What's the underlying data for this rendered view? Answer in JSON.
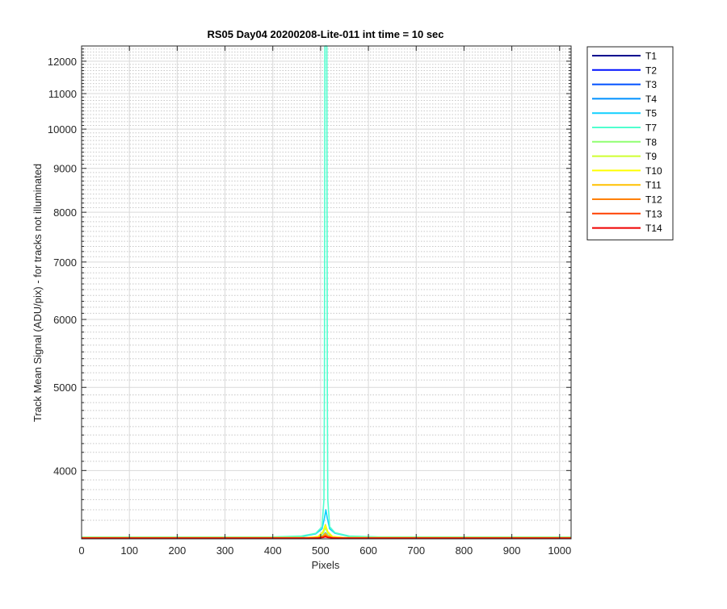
{
  "chart_data": {
    "type": "line",
    "title": "RS05 Day04 20200208-Lite-011 int time = 10 sec",
    "xlabel": "Pixels",
    "ylabel": "Track Mean Signal (ADU/pix) - for tracks not illuminated",
    "xlim": [
      0,
      1024
    ],
    "ylim": [
      3330,
      12500
    ],
    "yscale": "log",
    "grid": true,
    "legend_position": "outside-top-right",
    "x_ticks": [
      0,
      100,
      200,
      300,
      400,
      500,
      600,
      700,
      800,
      900,
      1000
    ],
    "x_tick_labels": [
      "0",
      "100",
      "200",
      "300",
      "400",
      "500",
      "600",
      "700",
      "800",
      "900",
      "1000"
    ],
    "y_ticks": [
      4000,
      5000,
      6000,
      7000,
      8000,
      9000,
      10000,
      11000,
      12000
    ],
    "y_tick_labels": [
      "4000",
      "5000",
      "6000",
      "7000",
      "8000",
      "9000",
      "10000",
      "11000",
      "12000"
    ],
    "y_minor_ticks": [
      3500,
      3600,
      3700,
      3800,
      3900,
      4100,
      4200,
      4300,
      4400,
      4500,
      4600,
      4700,
      4800,
      4900,
      5100,
      5200,
      5300,
      5400,
      5500,
      5600,
      5700,
      5800,
      5900,
      6100,
      6200,
      6300,
      6400,
      6500,
      6600,
      6700,
      6800,
      6900,
      7100,
      7200,
      7300,
      7400,
      7500,
      7600,
      7700,
      7800,
      7900,
      8100,
      8200,
      8300,
      8400,
      8500,
      8600,
      8700,
      8800,
      8900,
      9100,
      9200,
      9300,
      9400,
      9500,
      9600,
      9700,
      9800,
      9900,
      10100,
      10200,
      10300,
      10400,
      10500,
      10600,
      10700,
      10800,
      10900,
      11100,
      11200,
      11300,
      11400,
      11500,
      11600,
      11700,
      11800,
      11900,
      12100,
      12200,
      12300,
      12400
    ],
    "series": [
      {
        "name": "T1",
        "color": "#00008f",
        "x": [
          0,
          480,
          495,
          505,
          510,
          515,
          525,
          540,
          1024
        ],
        "y": [
          3340,
          3340,
          3342,
          3350,
          3365,
          3350,
          3342,
          3340,
          3340
        ]
      },
      {
        "name": "T2",
        "color": "#0010ff",
        "x": [
          0,
          480,
          495,
          505,
          510,
          515,
          525,
          540,
          1024
        ],
        "y": [
          3340,
          3340,
          3343,
          3355,
          3375,
          3355,
          3343,
          3340,
          3340
        ]
      },
      {
        "name": "T3",
        "color": "#0050ff",
        "x": [
          0,
          480,
          495,
          505,
          510,
          515,
          525,
          540,
          1024
        ],
        "y": [
          3340,
          3340,
          3343,
          3356,
          3378,
          3356,
          3343,
          3340,
          3340
        ]
      },
      {
        "name": "T4",
        "color": "#0090ff",
        "x": [
          0,
          480,
          495,
          505,
          510,
          515,
          525,
          540,
          1024
        ],
        "y": [
          3341,
          3341,
          3345,
          3360,
          3385,
          3360,
          3345,
          3341,
          3341
        ]
      },
      {
        "name": "T5",
        "color": "#10d0ff",
        "x": [
          0,
          400,
          460,
          490,
          503,
          508,
          511,
          514,
          519,
          530,
          560,
          620,
          1024
        ],
        "y": [
          3345,
          3345,
          3350,
          3375,
          3420,
          3520,
          3600,
          3520,
          3420,
          3380,
          3352,
          3346,
          3345
        ]
      },
      {
        "name": "T7",
        "color": "#50ffcf",
        "x": [
          0,
          400,
          460,
          490,
          503,
          507,
          508,
          509,
          510,
          511,
          512,
          513,
          514,
          515,
          519,
          530,
          560,
          620,
          1024
        ],
        "y": [
          3345,
          3347,
          3355,
          3380,
          3440,
          3700,
          5000,
          12500,
          12500,
          12500,
          12500,
          12500,
          5000,
          3700,
          3440,
          3385,
          3355,
          3347,
          3345
        ]
      },
      {
        "name": "T8",
        "color": "#8fff70",
        "x": [
          0,
          470,
          495,
          505,
          510,
          515,
          525,
          550,
          1024
        ],
        "y": [
          3341,
          3341,
          3348,
          3380,
          3430,
          3380,
          3348,
          3341,
          3341
        ]
      },
      {
        "name": "T9",
        "color": "#cfff30",
        "x": [
          0,
          470,
          495,
          505,
          510,
          515,
          525,
          550,
          1024
        ],
        "y": [
          3341,
          3341,
          3350,
          3395,
          3460,
          3395,
          3350,
          3341,
          3341
        ]
      },
      {
        "name": "T10",
        "color": "#ffff00",
        "x": [
          0,
          470,
          495,
          505,
          510,
          515,
          525,
          550,
          1024
        ],
        "y": [
          3340,
          3340,
          3349,
          3390,
          3450,
          3390,
          3349,
          3340,
          3340
        ]
      },
      {
        "name": "T11",
        "color": "#ffc000",
        "x": [
          0,
          480,
          495,
          505,
          510,
          515,
          525,
          540,
          1024
        ],
        "y": [
          3339,
          3339,
          3343,
          3358,
          3380,
          3358,
          3343,
          3339,
          3339
        ]
      },
      {
        "name": "T12",
        "color": "#ff8000",
        "x": [
          0,
          480,
          495,
          505,
          510,
          515,
          525,
          540,
          1024
        ],
        "y": [
          3338,
          3338,
          3341,
          3350,
          3365,
          3350,
          3341,
          3338,
          3338
        ]
      },
      {
        "name": "T13",
        "color": "#ff4000",
        "x": [
          0,
          480,
          495,
          505,
          510,
          515,
          525,
          540,
          1024
        ],
        "y": [
          3337,
          3337,
          3339,
          3345,
          3355,
          3345,
          3339,
          3337,
          3337
        ]
      },
      {
        "name": "T14",
        "color": "#ef0000",
        "x": [
          0,
          480,
          495,
          505,
          510,
          515,
          525,
          540,
          1024
        ],
        "y": [
          3336,
          3336,
          3338,
          3342,
          3348,
          3342,
          3338,
          3336,
          3336
        ]
      }
    ]
  }
}
